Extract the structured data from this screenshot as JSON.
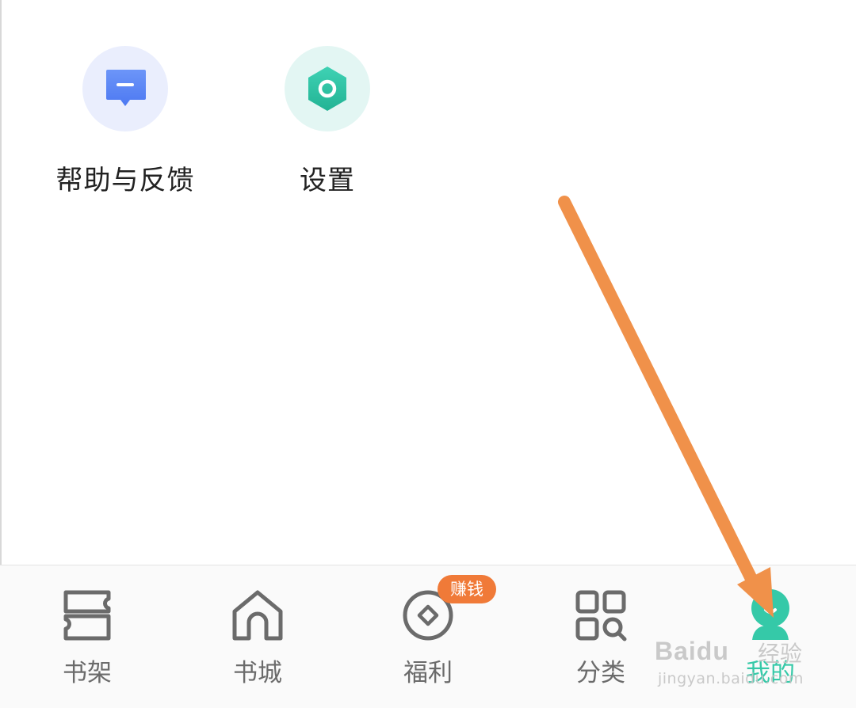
{
  "quick_items": [
    {
      "label": "帮助与反馈",
      "icon": "feedback-message-icon",
      "bg": "#eaeefd",
      "color": "#5b86f6"
    },
    {
      "label": "设置",
      "icon": "settings-hexagon-icon",
      "bg": "#e3f6f3",
      "color": "#2ec4a4"
    }
  ],
  "tabbar": {
    "tabs": [
      {
        "label": "书架",
        "icon": "bookshelf-icon"
      },
      {
        "label": "书城",
        "icon": "home-store-icon"
      },
      {
        "label": "福利",
        "icon": "coin-welfare-icon",
        "badge": "赚钱"
      },
      {
        "label": "分类",
        "icon": "category-grid-icon"
      },
      {
        "label": "我的",
        "icon": "profile-icon",
        "active": true
      }
    ],
    "active_color": "#35c9a8",
    "inactive_color": "#6b6b6b",
    "badge_color": "#f07a38"
  },
  "annotation": {
    "type": "arrow",
    "color": "#f0914a",
    "points_to": "我的"
  },
  "watermark": {
    "logo": "Baidu",
    "text": "经验",
    "url": "jingyan.baidu.com"
  }
}
